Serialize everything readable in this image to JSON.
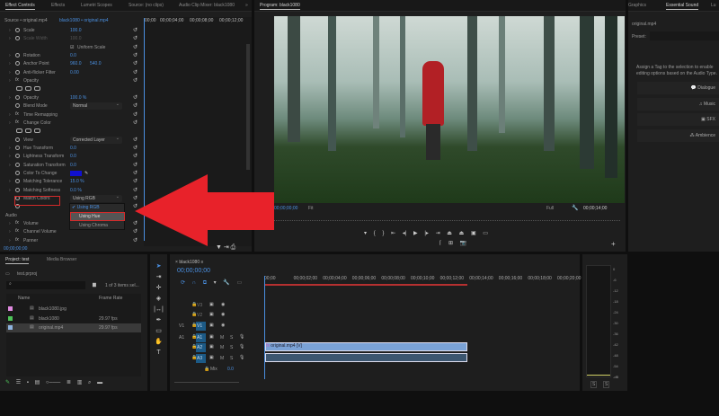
{
  "effect_controls": {
    "tabs": [
      "Effect Controls",
      "Effects",
      "Lumetri Scopes",
      "Source: (no clips)",
      "Audio Clip Mixer: black1080"
    ],
    "more": "»",
    "source": "Source • original.mp4",
    "sequence_clip": "black1080 • original.mp4",
    "ruler": [
      "00;00",
      "00;00;04;00",
      "00;00;08;00",
      "00;00;12;00"
    ],
    "rows": [
      {
        "kind": "prop",
        "label": "Scale",
        "value": "100.0"
      },
      {
        "kind": "prop",
        "label": "Scale Width",
        "value": "100.0",
        "disabled": true
      },
      {
        "kind": "check",
        "label": "Uniform Scale"
      },
      {
        "kind": "prop",
        "label": "Rotation",
        "value": "0.0"
      },
      {
        "kind": "prop",
        "label": "Anchor Point",
        "value": "960.0",
        "value2": "540.0"
      },
      {
        "kind": "prop",
        "label": "Anti-flicker Filter",
        "value": "0.00"
      },
      {
        "kind": "fx",
        "label": "Opacity"
      },
      {
        "kind": "icons"
      },
      {
        "kind": "prop",
        "label": "Opacity",
        "value": "100.0 %"
      },
      {
        "kind": "select",
        "label": "Blend Mode",
        "value": "Normal"
      },
      {
        "kind": "fx",
        "label": "Time Remapping"
      },
      {
        "kind": "fx",
        "label": "Change Color"
      },
      {
        "kind": "icons"
      },
      {
        "kind": "select",
        "label": "View",
        "value": "Corrected Layer"
      },
      {
        "kind": "prop",
        "label": "Hue Transform",
        "value": "0.0"
      },
      {
        "kind": "prop",
        "label": "Lightness Transform",
        "value": "0.0"
      },
      {
        "kind": "prop",
        "label": "Saturation Transform",
        "value": "0.0"
      },
      {
        "kind": "color",
        "label": "Color To Change"
      },
      {
        "kind": "prop",
        "label": "Matching Tolerance",
        "value": "15.0 %"
      },
      {
        "kind": "prop",
        "label": "Matching Softness",
        "value": "0.0 %"
      },
      {
        "kind": "select",
        "label": "Match Colors",
        "value": "Using RGB"
      },
      {
        "kind": "blank"
      },
      {
        "kind": "section",
        "label": "Audio"
      },
      {
        "kind": "fx",
        "label": "Volume"
      },
      {
        "kind": "fx",
        "label": "Channel Volume"
      },
      {
        "kind": "fx",
        "label": "Panner"
      }
    ],
    "dropdown_options": [
      "Using RGB",
      "Using Hue",
      "Using Chroma"
    ],
    "timecode": "00;00;00;00"
  },
  "program": {
    "title": "Program: black1080",
    "timecode": "00;00;00;00",
    "fit": "Fit",
    "quality": "Full",
    "duration": "00;00;14;00"
  },
  "essential_sound": {
    "tabs": [
      "Graphics",
      "Essential Sound",
      "Lu"
    ],
    "clip": "original.mp4",
    "preset_label": "Preset:",
    "hint": "Assign a Tag to the selection to enable editing options based on the Audio Type.",
    "tags": [
      "Dialogue",
      "Music",
      "SFX",
      "Ambience"
    ]
  },
  "project": {
    "tabs": [
      "Project: test",
      "Media Browser"
    ],
    "file": "test.prproj",
    "count": "1 of 3 items sel...",
    "columns": [
      "Name",
      "Frame Rate"
    ],
    "items": [
      {
        "name": "black1080.jpg",
        "fps": "",
        "color": "#e08ae0"
      },
      {
        "name": "black1080",
        "fps": "29.97 fps",
        "color": "#4fc45a"
      },
      {
        "name": "original.mp4",
        "fps": "29.97 fps",
        "color": "#8fb4e0"
      }
    ]
  },
  "timeline": {
    "title": "black1080",
    "timecode": "00;00;00;00",
    "ruler": [
      "00;00",
      "00;00;02;00",
      "00;00;04;00",
      "00;00;06;00",
      "00;00;08;00",
      "00;00;10;00",
      "00;00;12;00",
      "00;00;14;00",
      "00;00;16;00",
      "00;00;18;00",
      "00;00;20;00"
    ],
    "tracks": [
      "V3",
      "V2",
      "V1",
      "A1",
      "A2",
      "A3"
    ],
    "source_v": "V1",
    "source_a": "A1",
    "mix_label": "Mix",
    "mix_value": "0.0",
    "clip_label": "original.mp4 [V]",
    "m": "M",
    "s": "S"
  },
  "meters": {
    "scale": [
      "0",
      "-6",
      "-12",
      "-18",
      "-24",
      "-30",
      "-36",
      "-42",
      "-48",
      "-54",
      "-dB"
    ],
    "solo": [
      "S",
      "S"
    ]
  },
  "colors": {
    "accent": "#4a8fe0",
    "arrow": "#e8222a",
    "highlight": "#d42a2a"
  }
}
